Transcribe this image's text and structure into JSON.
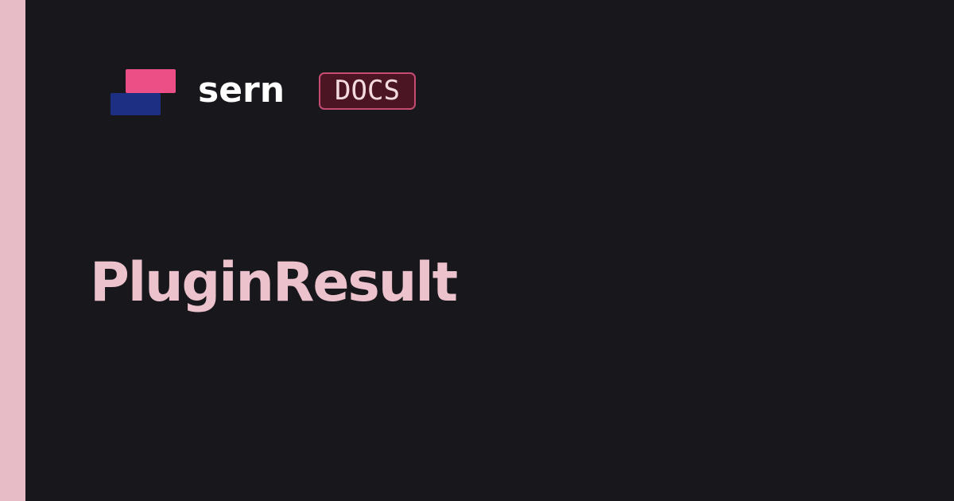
{
  "brand": {
    "name": "sern",
    "badge": "DOCS",
    "logo_icon": "sern-logo-icon"
  },
  "page": {
    "title": "PluginResult"
  },
  "colors": {
    "background": "#18181c",
    "accent_bar": "#e8bcc7",
    "title": "#ecc2cd",
    "logo_top": "#ec4f86",
    "logo_bottom": "#1d2f82",
    "badge_fill": "#4b1523",
    "badge_border": "#c44c71",
    "badge_text": "#f4dbe1"
  }
}
